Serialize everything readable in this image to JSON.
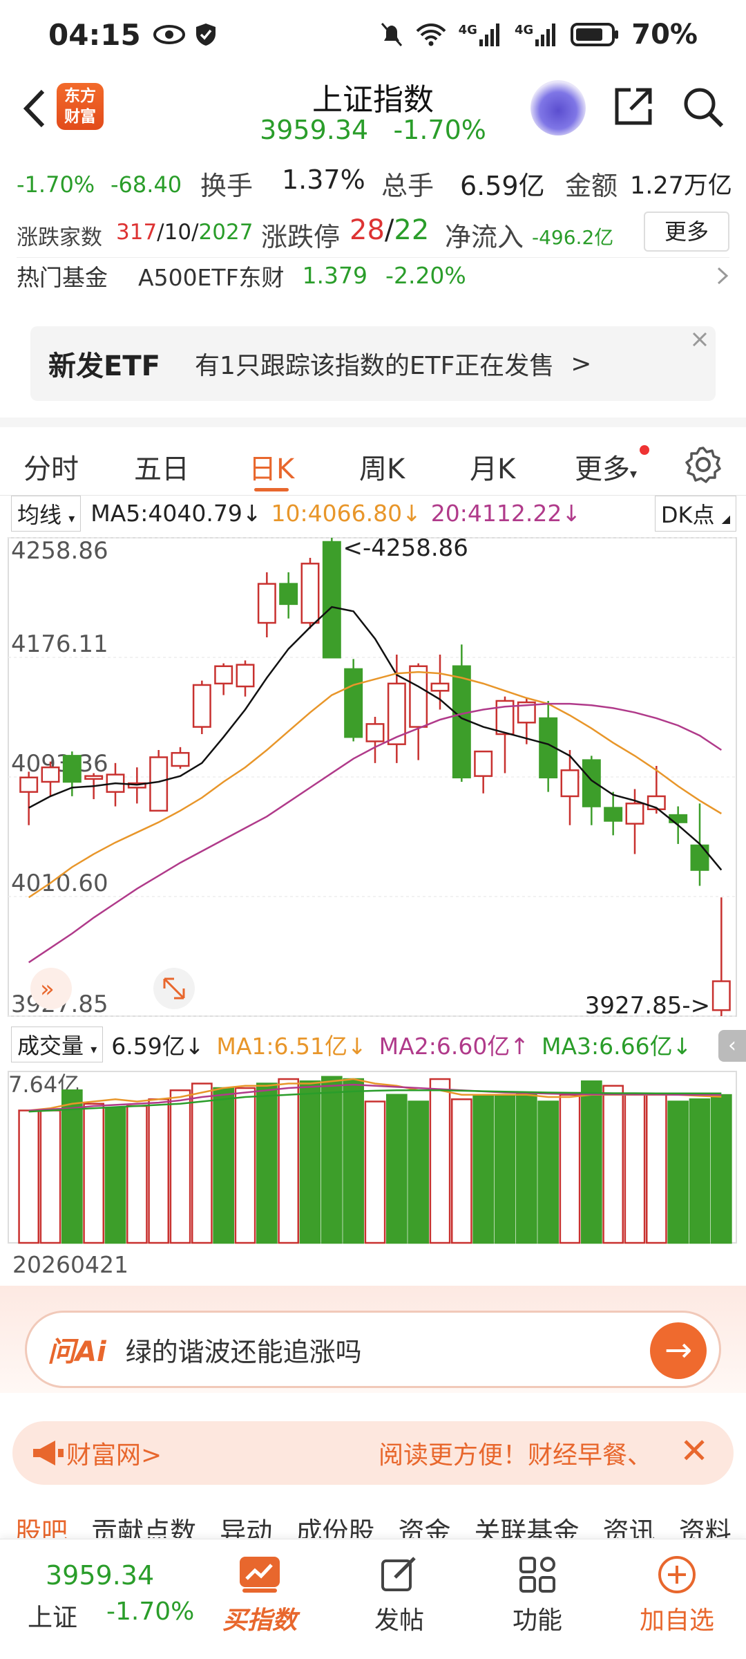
{
  "status_bar": {
    "time": "04:15",
    "battery": "70%",
    "net1": "4G",
    "net2": "4G"
  },
  "header": {
    "title": "上证指数",
    "price": "3959.34",
    "change_pct": "-1.70%",
    "logo_line1": "东方",
    "logo_line2": "财富"
  },
  "stats": {
    "chg_pct": "-1.70%",
    "chg_val": "-68.40",
    "turnover_label": "换手",
    "turnover": "1.37%",
    "volume_label": "总手",
    "volume": "6.59亿",
    "amount_label": "金额",
    "amount": "1.27万亿",
    "adv_label": "涨跌家数",
    "adv_up": "317",
    "adv_sep1": "/",
    "adv_flat": "10",
    "adv_sep2": "/",
    "adv_down": "2027",
    "limit_label": "涨跌停",
    "limit_up": "28",
    "limit_sep": "/",
    "limit_down": "22",
    "inflow_label": "净流入",
    "inflow": "-496.2亿",
    "more": "更多"
  },
  "fund_row": {
    "label": "热门基金",
    "name": "A500ETF东财",
    "price": "1.379",
    "pct": "-2.20%"
  },
  "etf_banner": {
    "tag": "新发ETF",
    "text": "有1只跟踪该指数的ETF正在发售",
    "arrow": ">"
  },
  "tabs": [
    {
      "label": "分时"
    },
    {
      "label": "五日"
    },
    {
      "label": "日K"
    },
    {
      "label": "周K"
    },
    {
      "label": "月K"
    },
    {
      "label": "更多"
    }
  ],
  "ma_bar": {
    "dropdown": "均线",
    "ma5": "MA5:4040.79↓",
    "ma10": "10:4066.80↓",
    "ma20": "20:4112.22↓",
    "dk": "DK点"
  },
  "chart_data": [
    {
      "type": "candlestick",
      "y_ticks": [
        "4258.86",
        "4176.11",
        "4093.36",
        "4010.60",
        "3927.85"
      ],
      "ylim": [
        3927.85,
        4258.86
      ],
      "high_annotation": "<-4258.86",
      "low_annotation": "3927.85->",
      "candles": [
        {
          "o": 4083,
          "h": 4097,
          "l": 4060,
          "c": 4093
        },
        {
          "o": 4090,
          "h": 4104,
          "l": 4080,
          "c": 4100
        },
        {
          "o": 4108,
          "h": 4111,
          "l": 4080,
          "c": 4090
        },
        {
          "o": 4092,
          "h": 4096,
          "l": 4078,
          "c": 4094
        },
        {
          "o": 4083,
          "h": 4103,
          "l": 4073,
          "c": 4095
        },
        {
          "o": 4086,
          "h": 4100,
          "l": 4075,
          "c": 4089
        },
        {
          "o": 4070,
          "h": 4112,
          "l": 4070,
          "c": 4107
        },
        {
          "o": 4101,
          "h": 4114,
          "l": 4099,
          "c": 4110
        },
        {
          "o": 4128,
          "h": 4160,
          "l": 4123,
          "c": 4157
        },
        {
          "o": 4158,
          "h": 4172,
          "l": 4150,
          "c": 4170
        },
        {
          "o": 4156,
          "h": 4174,
          "l": 4149,
          "c": 4171
        },
        {
          "o": 4200,
          "h": 4235,
          "l": 4190,
          "c": 4227
        },
        {
          "o": 4227,
          "h": 4235,
          "l": 4203,
          "c": 4213
        },
        {
          "o": 4200,
          "h": 4245,
          "l": 4196,
          "c": 4241
        },
        {
          "o": 4256,
          "h": 4258.86,
          "l": 4176,
          "c": 4176
        },
        {
          "o": 4168,
          "h": 4175,
          "l": 4118,
          "c": 4121
        },
        {
          "o": 4118,
          "h": 4135,
          "l": 4103,
          "c": 4130
        },
        {
          "o": 4116,
          "h": 4178,
          "l": 4103,
          "c": 4158
        },
        {
          "o": 4128,
          "h": 4172,
          "l": 4105,
          "c": 4170
        },
        {
          "o": 4153,
          "h": 4178,
          "l": 4140,
          "c": 4158
        },
        {
          "o": 4170,
          "h": 4185,
          "l": 4090,
          "c": 4093
        },
        {
          "o": 4094,
          "h": 4110,
          "l": 4082,
          "c": 4111
        },
        {
          "o": 4123,
          "h": 4149,
          "l": 4096,
          "c": 4146
        },
        {
          "o": 4131,
          "h": 4148,
          "l": 4116,
          "c": 4145
        },
        {
          "o": 4134,
          "h": 4146,
          "l": 4083,
          "c": 4093
        },
        {
          "o": 4080,
          "h": 4112,
          "l": 4060,
          "c": 4098
        },
        {
          "o": 4105,
          "h": 4108,
          "l": 4060,
          "c": 4073
        },
        {
          "o": 4072,
          "h": 4083,
          "l": 4053,
          "c": 4063
        },
        {
          "o": 4061,
          "h": 4085,
          "l": 4040,
          "c": 4075
        },
        {
          "o": 4071,
          "h": 4101,
          "l": 4068,
          "c": 4080
        },
        {
          "o": 4067,
          "h": 4073,
          "l": 4047,
          "c": 4062
        },
        {
          "o": 4046,
          "h": 4075,
          "l": 4018,
          "c": 4029
        },
        {
          "o": 3932,
          "h": 4010,
          "l": 3927.85,
          "c": 3952
        }
      ],
      "ma_series": [
        {
          "color": "#111111",
          "values": [
            4072,
            4080,
            4086,
            4087,
            4089,
            4088,
            4090,
            4094,
            4103,
            4121,
            4140,
            4162,
            4182,
            4197,
            4211,
            4208,
            4189,
            4164,
            4156,
            4147,
            4134,
            4128,
            4124,
            4120,
            4116,
            4108,
            4091,
            4081,
            4077,
            4072,
            4060,
            4047,
            4029
          ]
        },
        {
          "color": "#e8962a",
          "values": [
            4010,
            4020,
            4031,
            4040,
            4048,
            4055,
            4062,
            4070,
            4079,
            4090,
            4100,
            4112,
            4125,
            4138,
            4150,
            4157,
            4161,
            4165,
            4166,
            4165,
            4162,
            4158,
            4153,
            4148,
            4144,
            4136,
            4127,
            4117,
            4108,
            4098,
            4087,
            4077,
            4068
          ]
        },
        {
          "color": "#b03a8a",
          "values": [
            3965,
            3975,
            3985,
            3996,
            4006,
            4016,
            4025,
            4034,
            4042,
            4050,
            4058,
            4066,
            4076,
            4086,
            4096,
            4106,
            4114,
            4121,
            4127,
            4133,
            4137,
            4140,
            4142,
            4143,
            4144,
            4144,
            4143,
            4141,
            4138,
            4134,
            4129,
            4122,
            4112
          ]
        }
      ]
    },
    {
      "type": "bar",
      "title": "成交量",
      "y_tick": "7.64亿",
      "ylim": [
        0,
        7.64
      ],
      "values": [
        5.9,
        5.9,
        6.8,
        6.2,
        6.0,
        6.1,
        6.4,
        6.8,
        7.1,
        6.9,
        6.9,
        7.1,
        7.3,
        7.2,
        7.4,
        7.3,
        6.3,
        6.6,
        6.3,
        7.3,
        6.4,
        6.6,
        6.6,
        6.7,
        6.3,
        6.6,
        7.2,
        7.0,
        6.6,
        6.6,
        6.3,
        6.4,
        6.59
      ],
      "down": [
        false,
        false,
        true,
        false,
        true,
        false,
        false,
        false,
        false,
        true,
        false,
        true,
        false,
        true,
        true,
        true,
        false,
        true,
        true,
        false,
        false,
        true,
        true,
        true,
        true,
        false,
        true,
        false,
        false,
        false,
        true,
        true,
        true
      ],
      "ma_lines": [
        {
          "color": "#e8962a",
          "values": [
            5.9,
            6.0,
            6.2,
            6.3,
            6.4,
            6.3,
            6.4,
            6.5,
            6.7,
            6.9,
            7.0,
            7.0,
            7.1,
            7.1,
            7.2,
            7.3,
            7.1,
            7.0,
            6.8,
            6.8,
            6.6,
            6.6,
            6.6,
            6.6,
            6.5,
            6.5,
            6.6,
            6.6,
            6.6,
            6.6,
            6.6,
            6.55,
            6.51
          ]
        },
        {
          "color": "#b03a8a",
          "values": [
            5.9,
            5.95,
            6.0,
            6.1,
            6.15,
            6.2,
            6.25,
            6.35,
            6.5,
            6.6,
            6.7,
            6.8,
            6.9,
            6.95,
            7.0,
            7.05,
            7.0,
            6.95,
            6.9,
            6.85,
            6.8,
            6.75,
            6.7,
            6.68,
            6.65,
            6.63,
            6.62,
            6.62,
            6.61,
            6.61,
            6.6,
            6.6,
            6.6
          ]
        },
        {
          "color": "#2a9d2a",
          "values": [
            5.85,
            5.9,
            5.95,
            6.0,
            6.05,
            6.1,
            6.15,
            6.2,
            6.3,
            6.4,
            6.5,
            6.55,
            6.6,
            6.65,
            6.7,
            6.75,
            6.78,
            6.8,
            6.8,
            6.8,
            6.78,
            6.76,
            6.74,
            6.72,
            6.7,
            6.69,
            6.68,
            6.67,
            6.67,
            6.66,
            6.66,
            6.66,
            6.66
          ]
        }
      ]
    }
  ],
  "vol_bar": {
    "dropdown": "成交量",
    "vol": "6.59亿↓",
    "ma1": "MA1:6.51亿↓",
    "ma2": "MA2:6.60亿↑",
    "ma3": "MA3:6.66亿↓"
  },
  "date": "20260421",
  "ai": {
    "label": "问Ai",
    "question": "绿的谐波还能追涨吗",
    "go": "→"
  },
  "notice": {
    "source": "财富网>",
    "message": "阅读更方便！财经早餐、",
    "close": "✕"
  },
  "bottom_tabs": [
    "股吧",
    "贡献点数",
    "异动",
    "成份股",
    "资金",
    "关联基金",
    "资讯",
    "资料"
  ],
  "nav": {
    "index_price": "3959.34",
    "index_name": "上证",
    "index_pct": "-1.70%",
    "buy": "买指数",
    "post": "发帖",
    "func": "功能",
    "add": "加自选"
  }
}
